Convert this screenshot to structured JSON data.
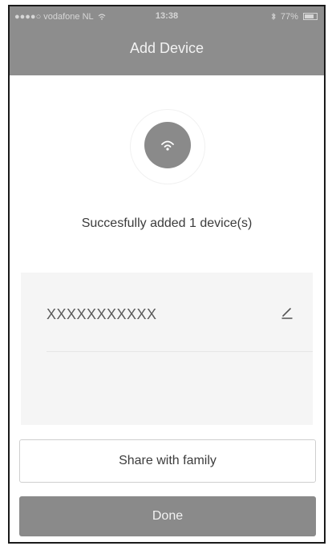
{
  "status_bar": {
    "carrier": "●●●●○ vodafone NL",
    "wifi_icon": "wifi-icon",
    "time": "13:38",
    "bluetooth_icon": "bluetooth-icon",
    "battery_percent": "77%",
    "battery_level": 0.77
  },
  "nav": {
    "title": "Add Device"
  },
  "success": {
    "icon": "wifi-icon",
    "message": "Succesfully added 1 device(s)"
  },
  "device": {
    "name": "XXXXXXXXXXX",
    "edit_icon": "pencil-icon"
  },
  "actions": {
    "share_label": "Share with family",
    "done_label": "Done"
  },
  "colors": {
    "bar": "#8d8d8d",
    "button": "#8a8a8a",
    "panel": "#f5f5f5"
  }
}
